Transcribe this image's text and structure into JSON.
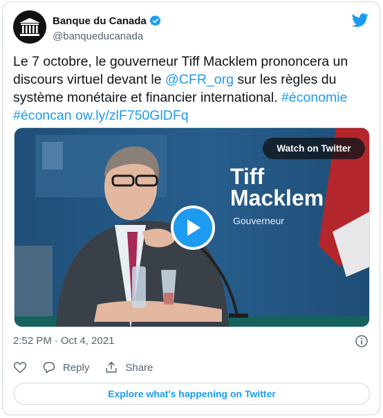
{
  "account": {
    "name": "Banque du Canada",
    "handle": "@banqueducanada",
    "verified": true,
    "avatar_icon": "bank-building-icon"
  },
  "tweet": {
    "text_parts": [
      "Le 7 octobre, le gouverneur Tiff Macklem prononcera un discours virtuel devant le ",
      "@CFR_org",
      " sur les règles du système monétaire et financier international. ",
      "#économie",
      " ",
      "#éconcan",
      " ",
      "ow.ly/zlF750GlDFq"
    ]
  },
  "media": {
    "watch_label": "Watch on Twitter",
    "overlay_name_line1": "Tiff",
    "overlay_name_line2": "Macklem",
    "overlay_role": "Gouverneur",
    "play_icon": "play-icon"
  },
  "meta": {
    "time": "2:52 PM",
    "separator": "·",
    "date": "Oct 4, 2021"
  },
  "actions": {
    "like_icon": "heart-icon",
    "reply_label": "Reply",
    "share_label": "Share"
  },
  "explore_label": "Explore what's happening on Twitter",
  "colors": {
    "accent": "#1d9bf0",
    "text": "#0f1419",
    "secondary": "#536471",
    "border": "#cfd9de"
  }
}
